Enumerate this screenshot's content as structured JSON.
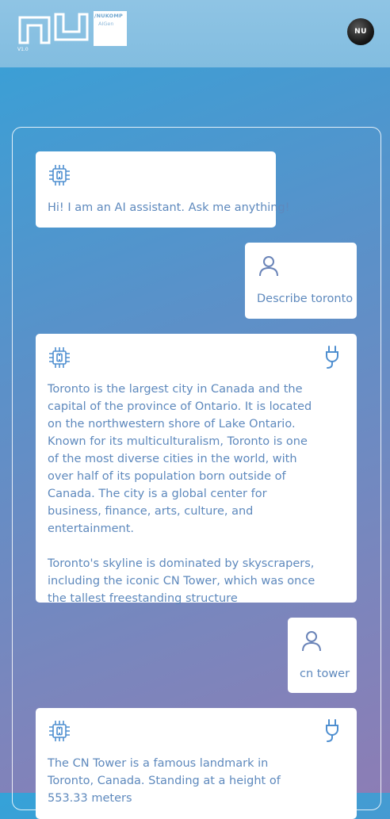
{
  "header": {
    "logo_brand": "NUKOMP",
    "logo_sub": "AIGen",
    "logo_slash": "/",
    "version": "V1.0",
    "avatar_text": "NU"
  },
  "messages": [
    {
      "role": "assistant",
      "text": "Hi! I am an AI assistant. Ask me anything!"
    },
    {
      "role": "user",
      "text": "Describe toronto"
    },
    {
      "role": "assistant",
      "paragraphs": [
        "Toronto is the largest city in Canada and the capital of the province of Ontario. It is located on the northwestern shore of Lake Ontario. Known for its multiculturalism, Toronto is one of the most diverse cities in the world, with over half of its population born outside of Canada. The city is a global center for business, finance, arts, culture, and entertainment.",
        "Toronto's skyline is dominated by skyscrapers, including the iconic CN Tower, which was once the tallest freestanding structure"
      ]
    },
    {
      "role": "user",
      "text": "cn tower"
    },
    {
      "role": "assistant",
      "paragraphs": [
        "The CN Tower is a famous landmark in Toronto, Canada. Standing at a height of 553.33 meters"
      ]
    }
  ],
  "colors": {
    "accent": "#5e89bd",
    "icon": "#4f8fd0",
    "user_icon": "#6a84b8"
  },
  "icons": [
    "cpu-icon",
    "user-icon",
    "plug-icon"
  ]
}
